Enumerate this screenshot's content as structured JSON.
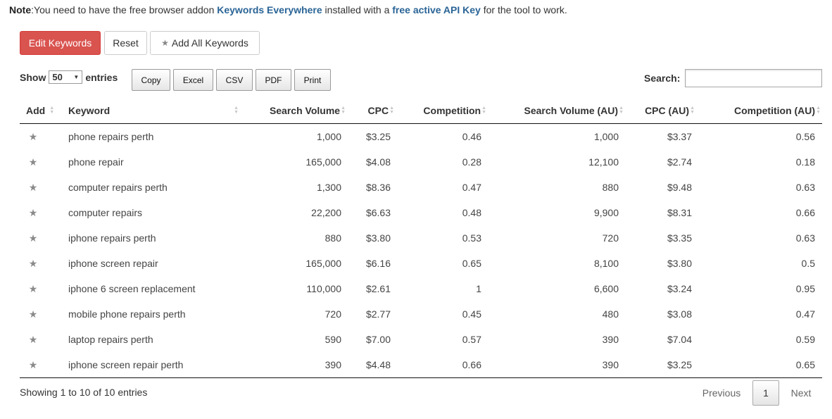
{
  "note": {
    "label": "Note",
    "text1": ":You need to have the free browser addon ",
    "link1": "Keywords Everywhere",
    "text2": " installed with a ",
    "link2": "free active API Key",
    "text3": " for the tool to work."
  },
  "actions": {
    "edit_keywords": "Edit Keywords",
    "reset": "Reset",
    "add_all": "Add All Keywords"
  },
  "length": {
    "show": "Show",
    "value": "50",
    "entries": "entries"
  },
  "export_buttons": [
    "Copy",
    "Excel",
    "CSV",
    "PDF",
    "Print"
  ],
  "search": {
    "label": "Search:",
    "value": ""
  },
  "columns": [
    "Add",
    "Keyword",
    "Search Volume",
    "CPC",
    "Competition",
    "Search Volume (AU)",
    "CPC (AU)",
    "Competition (AU)"
  ],
  "rows": [
    [
      "phone repairs perth",
      "1,000",
      "$3.25",
      "0.46",
      "1,000",
      "$3.37",
      "0.56"
    ],
    [
      "phone repair",
      "165,000",
      "$4.08",
      "0.28",
      "12,100",
      "$2.74",
      "0.18"
    ],
    [
      "computer repairs perth",
      "1,300",
      "$8.36",
      "0.47",
      "880",
      "$9.48",
      "0.63"
    ],
    [
      "computer repairs",
      "22,200",
      "$6.63",
      "0.48",
      "9,900",
      "$8.31",
      "0.66"
    ],
    [
      "iphone repairs perth",
      "880",
      "$3.80",
      "0.53",
      "720",
      "$3.35",
      "0.63"
    ],
    [
      "iphone screen repair",
      "165,000",
      "$6.16",
      "0.65",
      "8,100",
      "$3.80",
      "0.5"
    ],
    [
      "iphone 6 screen replacement",
      "110,000",
      "$2.61",
      "1",
      "6,600",
      "$3.24",
      "0.95"
    ],
    [
      "mobile phone repairs perth",
      "720",
      "$2.77",
      "0.45",
      "480",
      "$3.08",
      "0.47"
    ],
    [
      "laptop repairs perth",
      "590",
      "$7.00",
      "0.57",
      "390",
      "$7.04",
      "0.59"
    ],
    [
      "iphone screen repair perth",
      "390",
      "$4.48",
      "0.66",
      "390",
      "$3.25",
      "0.65"
    ]
  ],
  "info": "Showing 1 to 10 of 10 entries",
  "pagination": {
    "previous": "Previous",
    "current": "1",
    "next": "Next"
  },
  "colors": {
    "danger": "#d9534f",
    "link": "#2a6496"
  },
  "icons": {
    "row_add": "star-icon",
    "add_all": "star-icon"
  }
}
